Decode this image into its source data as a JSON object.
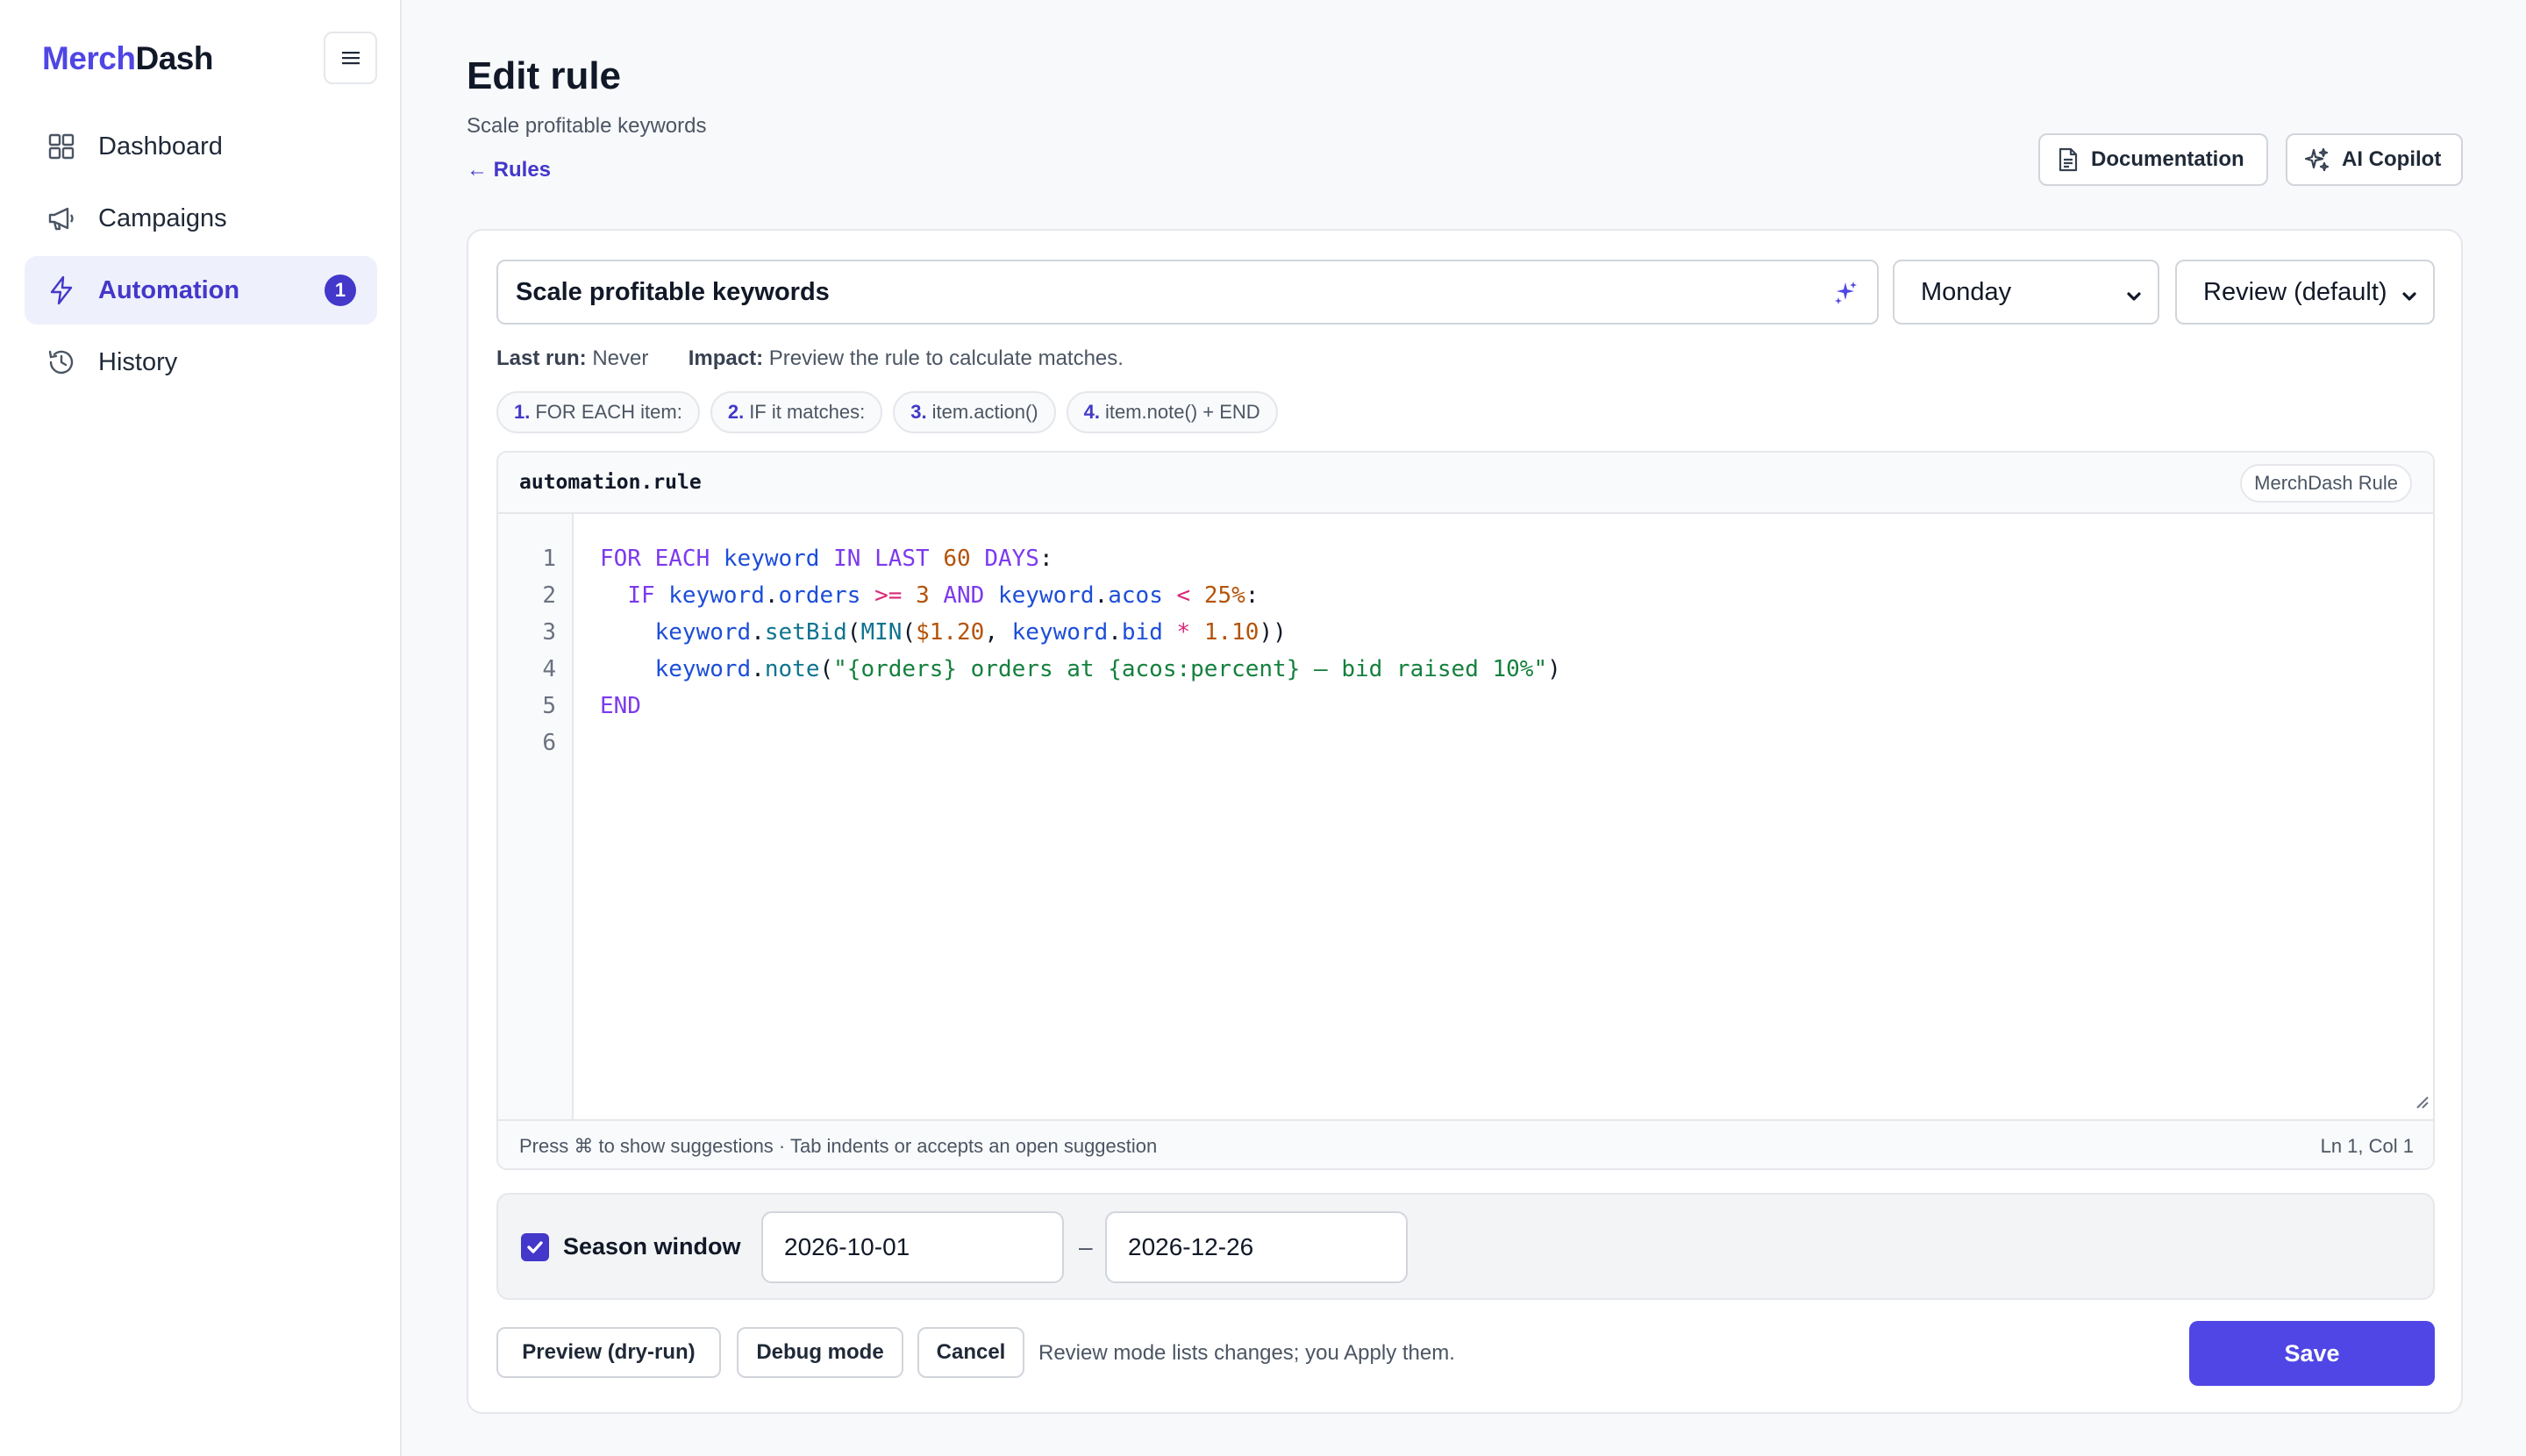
{
  "brand": {
    "part1": "Merch",
    "part2": "Dash"
  },
  "sidebar": {
    "items": [
      {
        "label": "Dashboard",
        "icon": "grid-icon"
      },
      {
        "label": "Campaigns",
        "icon": "megaphone-icon"
      },
      {
        "label": "Automation",
        "icon": "bolt-icon",
        "badge": "1",
        "active": true
      },
      {
        "label": "History",
        "icon": "history-icon"
      }
    ]
  },
  "header": {
    "title": "Edit rule",
    "subtitle": "Scale profitable keywords",
    "back_link": "← Rules",
    "documentation_label": "Documentation",
    "copilot_label": "AI Copilot"
  },
  "form": {
    "rule_name": "Scale profitable keywords",
    "schedule": "Monday",
    "mode": "Review (default)"
  },
  "meta": {
    "last_run_label": "Last run:",
    "last_run_value": "Never",
    "impact_label": "Impact:",
    "impact_value": "Preview the rule to calculate matches."
  },
  "steps": [
    {
      "num": "1.",
      "text": "FOR EACH item:"
    },
    {
      "num": "2.",
      "text": "IF it matches:"
    },
    {
      "num": "3.",
      "text": "item.action()"
    },
    {
      "num": "4.",
      "text": "item.note() + END"
    }
  ],
  "editor": {
    "filename": "automation.rule",
    "language": "MerchDash Rule",
    "line_numbers": [
      "1",
      "2",
      "3",
      "4",
      "5",
      "6"
    ],
    "lines": [
      [
        [
          "kw",
          "FOR EACH "
        ],
        [
          "id",
          "keyword"
        ],
        [
          "kw",
          " IN LAST "
        ],
        [
          "num",
          "60"
        ],
        [
          "kw",
          " DAYS"
        ],
        [
          "pl",
          ":"
        ]
      ],
      [
        [
          "pl",
          "  "
        ],
        [
          "kw",
          "IF "
        ],
        [
          "id",
          "keyword"
        ],
        [
          "pl",
          "."
        ],
        [
          "id",
          "orders"
        ],
        [
          "op",
          " >= "
        ],
        [
          "num",
          "3"
        ],
        [
          "kw",
          " AND "
        ],
        [
          "id",
          "keyword"
        ],
        [
          "pl",
          "."
        ],
        [
          "id",
          "acos"
        ],
        [
          "op",
          " < "
        ],
        [
          "num",
          "25%"
        ],
        [
          "pl",
          ":"
        ]
      ],
      [
        [
          "pl",
          "    "
        ],
        [
          "id",
          "keyword"
        ],
        [
          "pl",
          "."
        ],
        [
          "fn",
          "setBid"
        ],
        [
          "pl",
          "("
        ],
        [
          "fn",
          "MIN"
        ],
        [
          "pl",
          "("
        ],
        [
          "num",
          "$1.20"
        ],
        [
          "pl",
          ", "
        ],
        [
          "id",
          "keyword"
        ],
        [
          "pl",
          "."
        ],
        [
          "id",
          "bid"
        ],
        [
          "op",
          " * "
        ],
        [
          "num",
          "1.10"
        ],
        [
          "pl",
          "))"
        ]
      ],
      [
        [
          "pl",
          "    "
        ],
        [
          "id",
          "keyword"
        ],
        [
          "pl",
          "."
        ],
        [
          "fn",
          "note"
        ],
        [
          "pl",
          "("
        ],
        [
          "str",
          "\"{orders} orders at {acos:percent} — bid raised 10%\""
        ],
        [
          "pl",
          ")"
        ]
      ],
      [
        [
          "kw",
          "END"
        ]
      ],
      []
    ],
    "hint": "Press ⌘ to show suggestions · Tab indents or accepts an open suggestion",
    "cursor": "Ln 1, Col 1"
  },
  "season": {
    "label": "Season window",
    "checked": true,
    "start": "2026-10-01",
    "separator": "–",
    "end": "2026-12-26"
  },
  "actions": {
    "preview": "Preview (dry-run)",
    "debug": "Debug mode",
    "cancel": "Cancel",
    "note": "Review mode lists changes; you Apply them.",
    "save": "Save"
  },
  "colors": {
    "accent": "#4f46e5",
    "accent_dark": "#4338ca"
  }
}
